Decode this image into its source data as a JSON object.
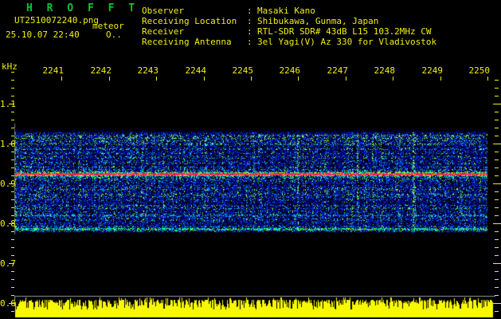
{
  "app": {
    "title": "H R O F F T"
  },
  "header": {
    "filename": "UT2510072240.png",
    "mode_label": "meteor",
    "datetime": "25.10.07 22:40",
    "status_indicator": "O.."
  },
  "info": {
    "colon": ":",
    "rows": [
      {
        "label": "Observer",
        "value": "Masaki Kano"
      },
      {
        "label": "Receiving Location",
        "value": "Shibukawa, Gunma, Japan"
      },
      {
        "label": "Receiver",
        "value": "RTL-SDR SDR# 43dB L15 103.2MHz CW"
      },
      {
        "label": "Receiving Antenna",
        "value": "3el Yagi(V) Az 330 for Vladivostok"
      }
    ]
  },
  "axes": {
    "y_unit": "kHz",
    "y_ticks": [
      "1.1",
      "1.0",
      "0.9",
      "0.8",
      "0.7",
      "0.6"
    ],
    "x_ticks": [
      "2241",
      "2242",
      "2243",
      "2244",
      "2245",
      "2246",
      "2247",
      "2248",
      "2249",
      "2250"
    ]
  },
  "chart_data": {
    "type": "heatmap",
    "title": "HROFFT 10-minute meteor radio observation spectrogram",
    "time_axis": {
      "start_ut": "22:40",
      "end_ut": "22:50",
      "tick_labels": [
        "2241",
        "2242",
        "2243",
        "2244",
        "2245",
        "2246",
        "2247",
        "2248",
        "2249",
        "2250"
      ]
    },
    "freq_axis": {
      "unit": "kHz",
      "tick_values": [
        1.1,
        1.0,
        0.9,
        0.8,
        0.7,
        0.6
      ],
      "visible_top_khz": 1.16,
      "visible_bottom_khz": 0.56
    },
    "noise_band_khz": [
      0.774,
      1.042
    ],
    "spectral_lines": [
      {
        "khz": 0.924,
        "appearance": "strong continuous red/pink carrier with yellow-green fringe and cyan halo"
      },
      {
        "khz": 0.82,
        "appearance": "faint broken cyan line"
      },
      {
        "khz": 0.786,
        "appearance": "green-cyan line with sparse orange specks"
      }
    ],
    "signal_strength_strip": {
      "type": "area",
      "description": "jagged yellow noise-floor strip along bottom, no meteor ping spikes",
      "gray_rule_khz": 0.618
    },
    "colors": {
      "background": "#000000",
      "text_yellow": "#efef10",
      "title_green": "#00c832",
      "gray_line": "#989898",
      "strip_yellow": "#f8f800",
      "noise_palette": [
        "#000046",
        "#00008c",
        "#0018c0",
        "#0038e8",
        "#0070ff",
        "#00b4ff",
        "#00f0e0",
        "#00ff80",
        "#90ff50"
      ],
      "carrier_core": [
        "#f02858",
        "#ff3868",
        "#d81040"
      ],
      "carrier_fringe": [
        "#c0ff00",
        "#ffee00",
        "#00ff88",
        "#00ffcc",
        "#ff4466"
      ],
      "halo_cyan": [
        "#00c8ff",
        "#00ffd0",
        "#00ff70",
        "#0080ff",
        "#b0ff30"
      ],
      "faint_line": [
        "#0090ff",
        "#00d0ff",
        "#00ffff",
        "#0050e0"
      ],
      "green_line": [
        "#00ff90",
        "#00ffff",
        "#30ff40",
        "#00b0ff",
        "#80ff00"
      ],
      "green_line_specks": [
        "#ff8800",
        "#ff4400"
      ]
    }
  }
}
